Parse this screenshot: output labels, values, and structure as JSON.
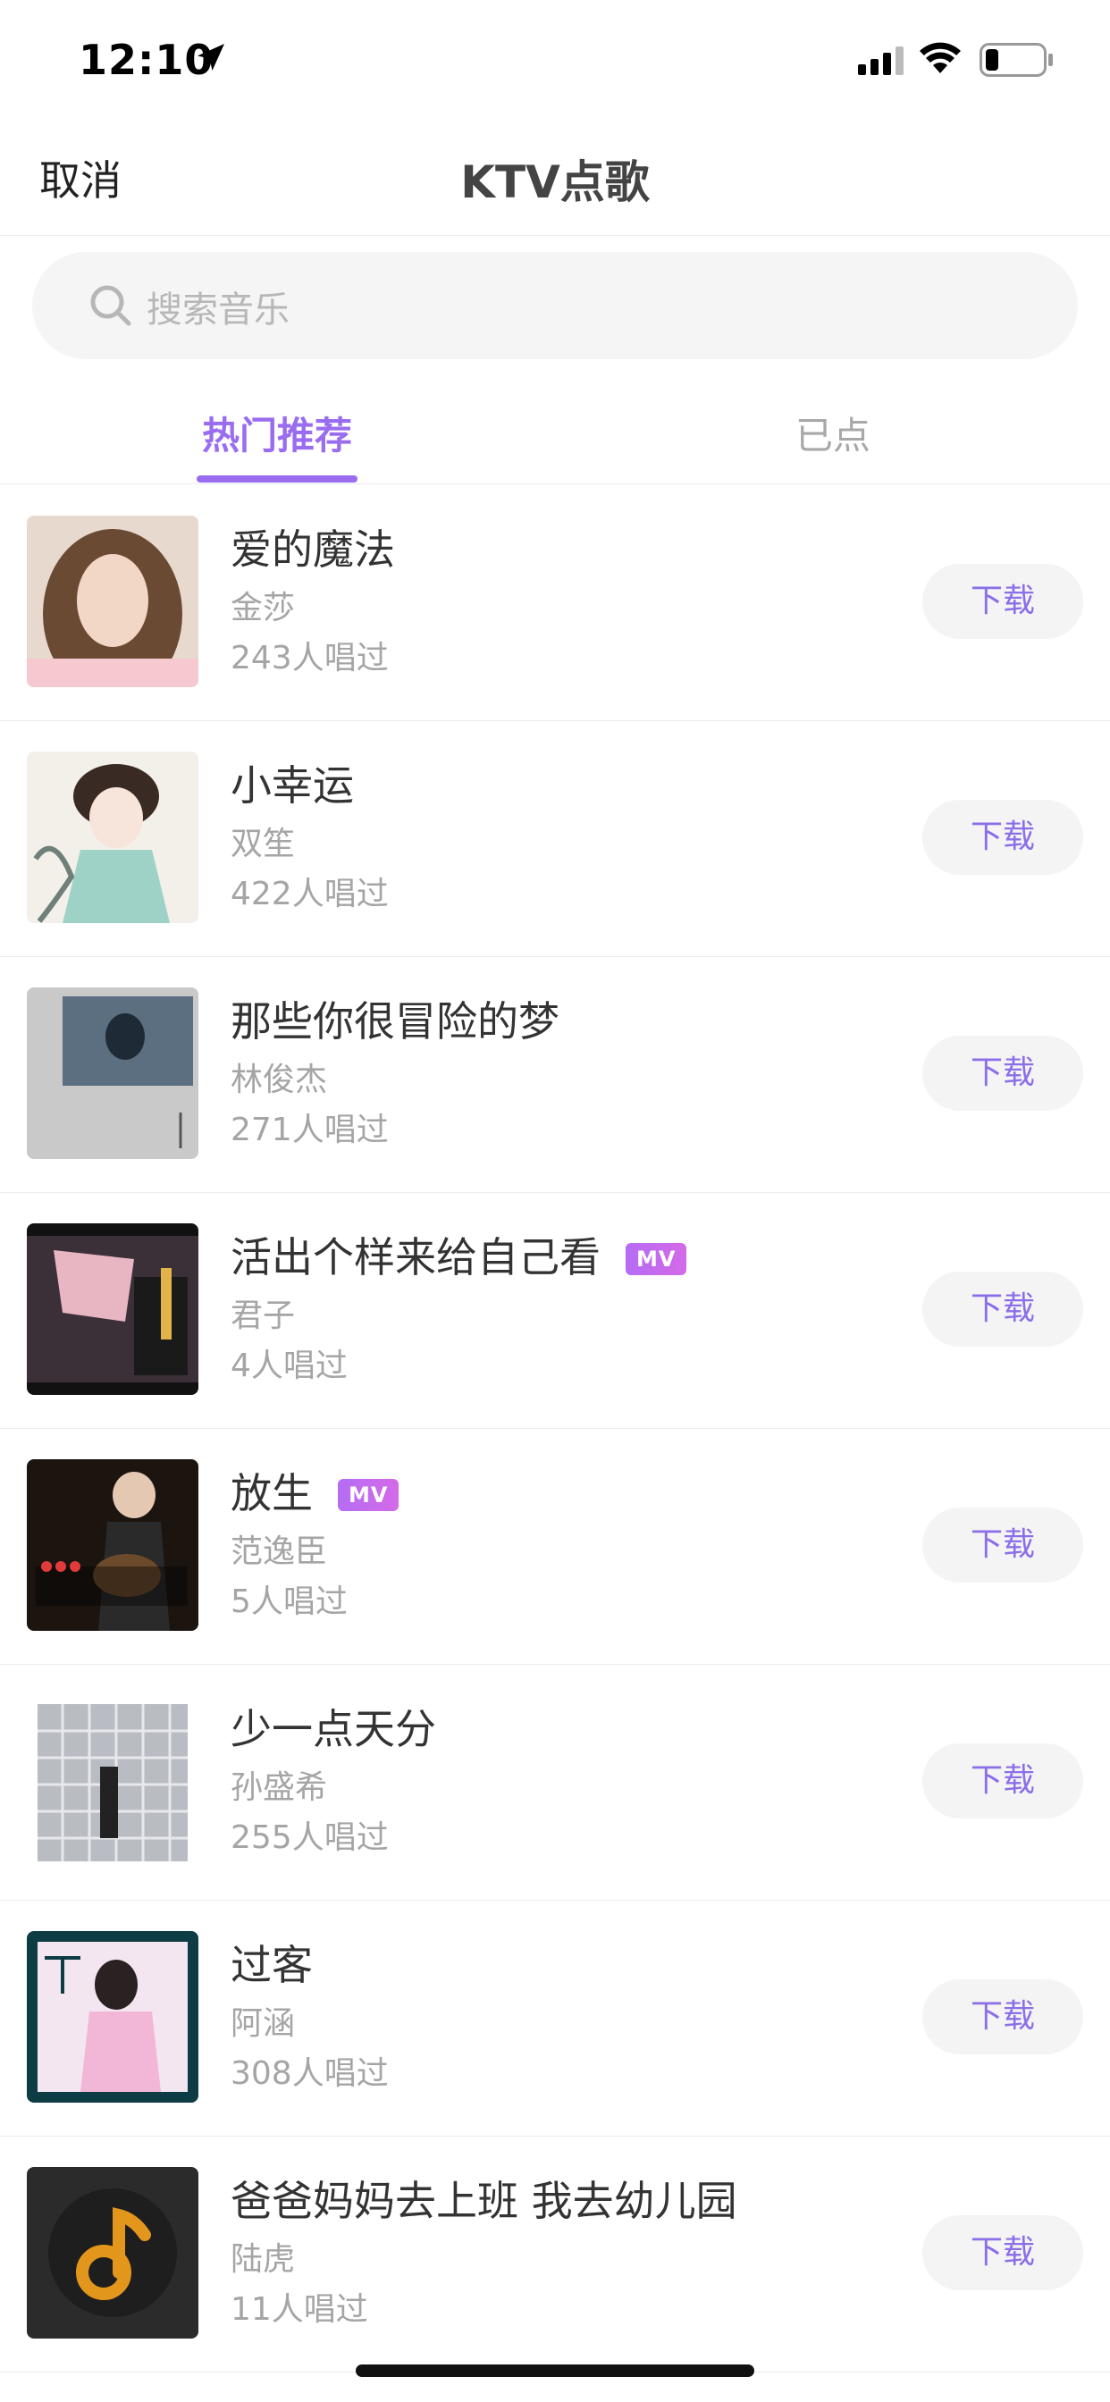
{
  "status_bar": {
    "time": "12:10"
  },
  "nav": {
    "cancel_label": "取消",
    "title": "KTV点歌"
  },
  "search": {
    "placeholder": "搜索音乐"
  },
  "tabs": [
    {
      "label": "热门推荐",
      "active": true
    },
    {
      "label": "已点",
      "active": false
    }
  ],
  "colors": {
    "accent": "#9a6cf0",
    "download_text": "#8b6ee8",
    "mv_badge": "#c46cf0"
  },
  "songs": [
    {
      "title": "爱的魔法",
      "artist": "金莎",
      "count": "243人唱过",
      "mv": null,
      "download_label": "下载"
    },
    {
      "title": "小幸运",
      "artist": "双笙",
      "count": "422人唱过",
      "mv": null,
      "download_label": "下载"
    },
    {
      "title": "那些你很冒险的梦",
      "artist": "林俊杰",
      "count": "271人唱过",
      "mv": null,
      "download_label": "下载"
    },
    {
      "title": "活出个样来给自己看",
      "artist": "君子",
      "count": "4人唱过",
      "mv": "MV",
      "download_label": "下载"
    },
    {
      "title": "放生",
      "artist": "范逸臣",
      "count": "5人唱过",
      "mv": "MV",
      "download_label": "下载"
    },
    {
      "title": "少一点天分",
      "artist": "孙盛希",
      "count": "255人唱过",
      "mv": null,
      "download_label": "下载"
    },
    {
      "title": "过客",
      "artist": "阿涵",
      "count": "308人唱过",
      "mv": null,
      "download_label": "下载"
    },
    {
      "title": "爸爸妈妈去上班 我去幼儿园",
      "artist": "陆虎",
      "count": "11人唱过",
      "mv": null,
      "download_label": "下载"
    }
  ]
}
